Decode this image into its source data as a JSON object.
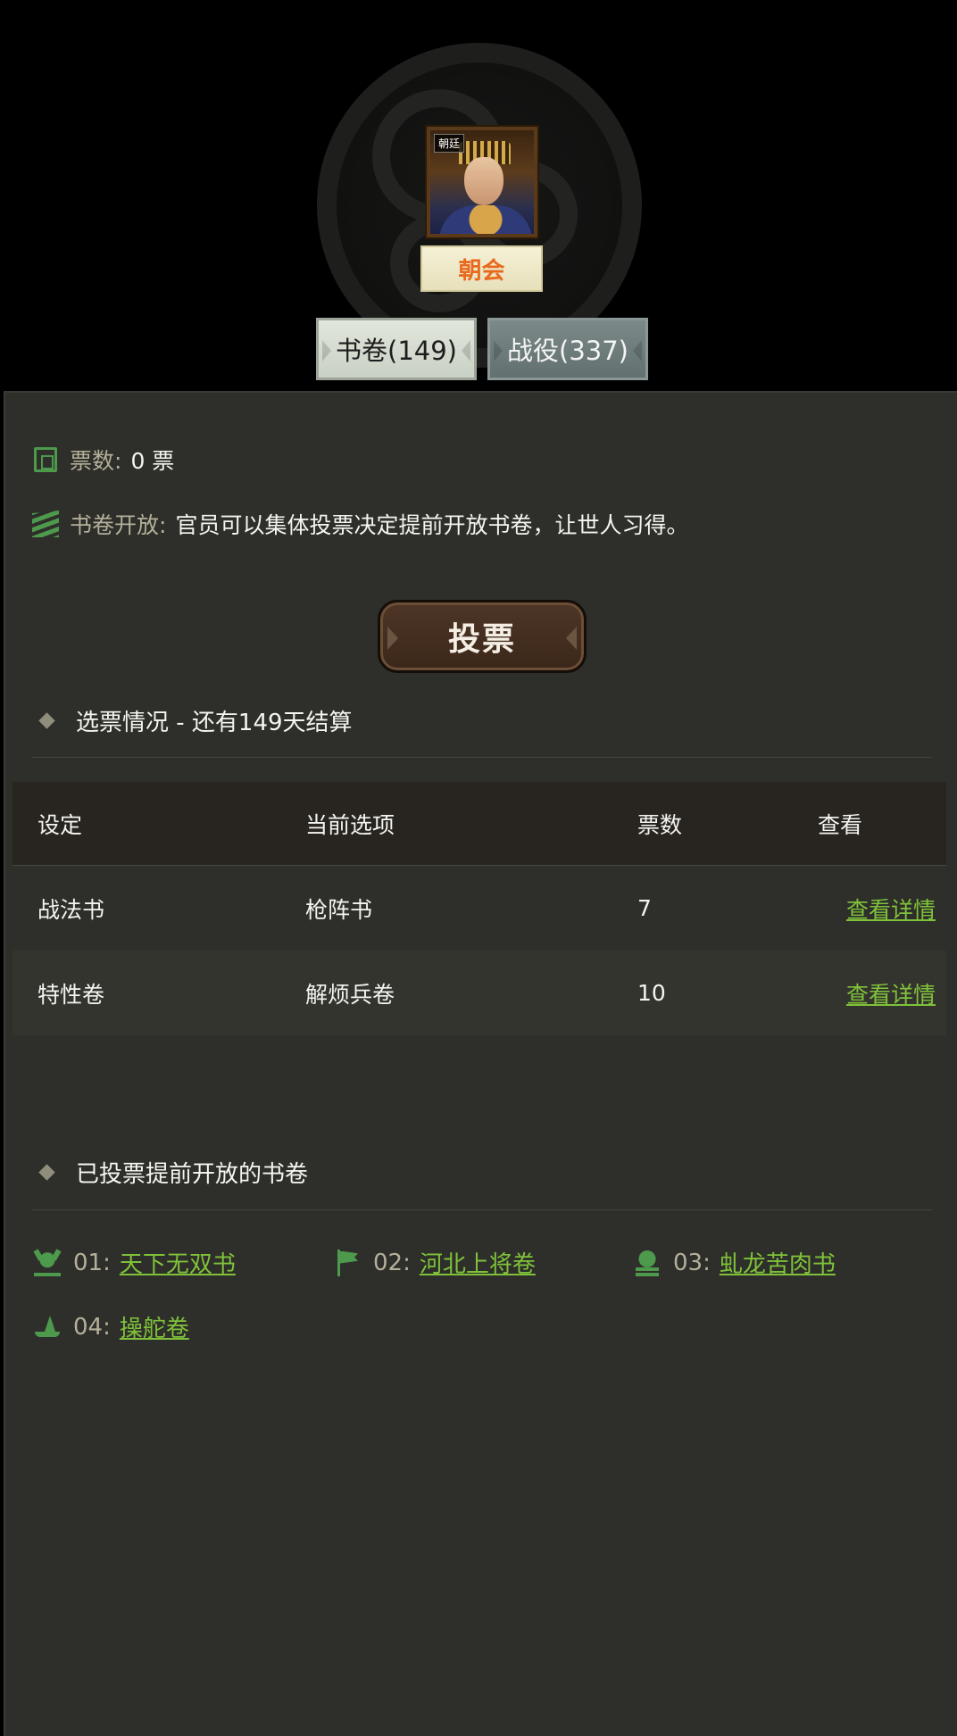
{
  "header": {
    "portrait_tag": "朝廷",
    "court_button": "朝会",
    "tabs": [
      {
        "label": "书卷(149)",
        "active": true
      },
      {
        "label": "战役(337)",
        "active": false
      }
    ]
  },
  "info": {
    "votes_label": "票数:",
    "votes_value": "0 票",
    "open_label": "书卷开放:",
    "open_value": "官员可以集体投票决定提前开放书卷，让世人习得。"
  },
  "vote_button": "投票",
  "poll_section": {
    "title": "选票情况 - 还有149天结算",
    "columns": [
      "设定",
      "当前选项",
      "票数",
      "查看"
    ],
    "rows": [
      {
        "setting": "战法书",
        "option": "枪阵书",
        "votes": "7",
        "view": "查看详情"
      },
      {
        "setting": "特性卷",
        "option": "解烦兵卷",
        "votes": "10",
        "view": "查看详情"
      }
    ]
  },
  "opened_section": {
    "title": "已投票提前开放的书卷",
    "books": [
      {
        "num": "01:",
        "name": "天下无双书",
        "icon": "demon-mask-icon"
      },
      {
        "num": "02:",
        "name": "河北上将卷",
        "icon": "flag-icon"
      },
      {
        "num": "03:",
        "name": "虬龙苦肉书",
        "icon": "skull-icon"
      },
      {
        "num": "04:",
        "name": "操舵卷",
        "icon": "ship-icon"
      }
    ]
  },
  "colors": {
    "accent_green": "#7fc23a",
    "icon_green": "#4d9a4d",
    "court_orange": "#e86a1e",
    "panel_bg": "#2e2e2a"
  }
}
